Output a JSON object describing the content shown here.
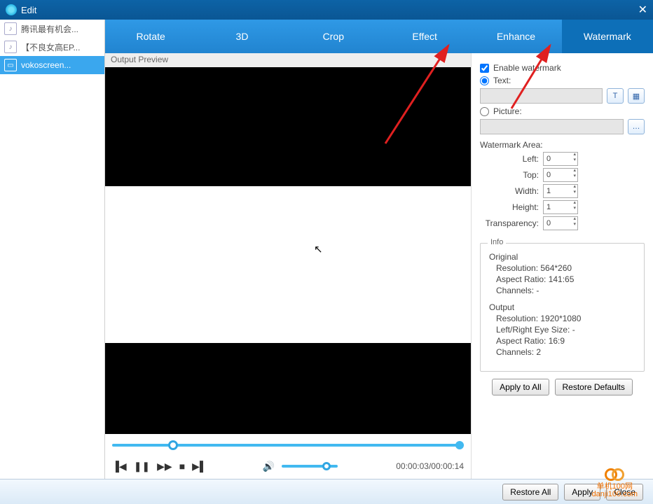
{
  "title": "Edit",
  "files": [
    {
      "label": "腾讯最有机会..."
    },
    {
      "label": "【不良女高EP..."
    },
    {
      "label": "vokoscreen..."
    }
  ],
  "tabs": {
    "rotate": "Rotate",
    "threeD": "3D",
    "crop": "Crop",
    "effect": "Effect",
    "enhance": "Enhance",
    "watermark": "Watermark"
  },
  "preview_label": "Output Preview",
  "watermark": {
    "enable": "Enable watermark",
    "text_label": "Text:",
    "picture_label": "Picture:",
    "area_label": "Watermark Area:",
    "left_label": "Left:",
    "left_val": "0",
    "top_label": "Top:",
    "top_val": "0",
    "width_label": "Width:",
    "width_val": "1",
    "height_label": "Height:",
    "height_val": "1",
    "trans_label": "Transparency:",
    "trans_val": "0"
  },
  "info": {
    "legend": "Info",
    "original": {
      "head": "Original",
      "res": "Resolution: 564*260",
      "ar": "Aspect Ratio: 141:65",
      "ch": "Channels: -"
    },
    "output": {
      "head": "Output",
      "res": "Resolution: 1920*1080",
      "eye": "Left/Right Eye Size: -",
      "ar": "Aspect Ratio: 16:9",
      "ch": "Channels: 2"
    }
  },
  "panel_buttons": {
    "apply_all": "Apply to All",
    "restore_def": "Restore Defaults"
  },
  "footer": {
    "restore_all": "Restore All",
    "apply": "Apply",
    "close": "Close"
  },
  "time": "00:00:03/00:00:14"
}
